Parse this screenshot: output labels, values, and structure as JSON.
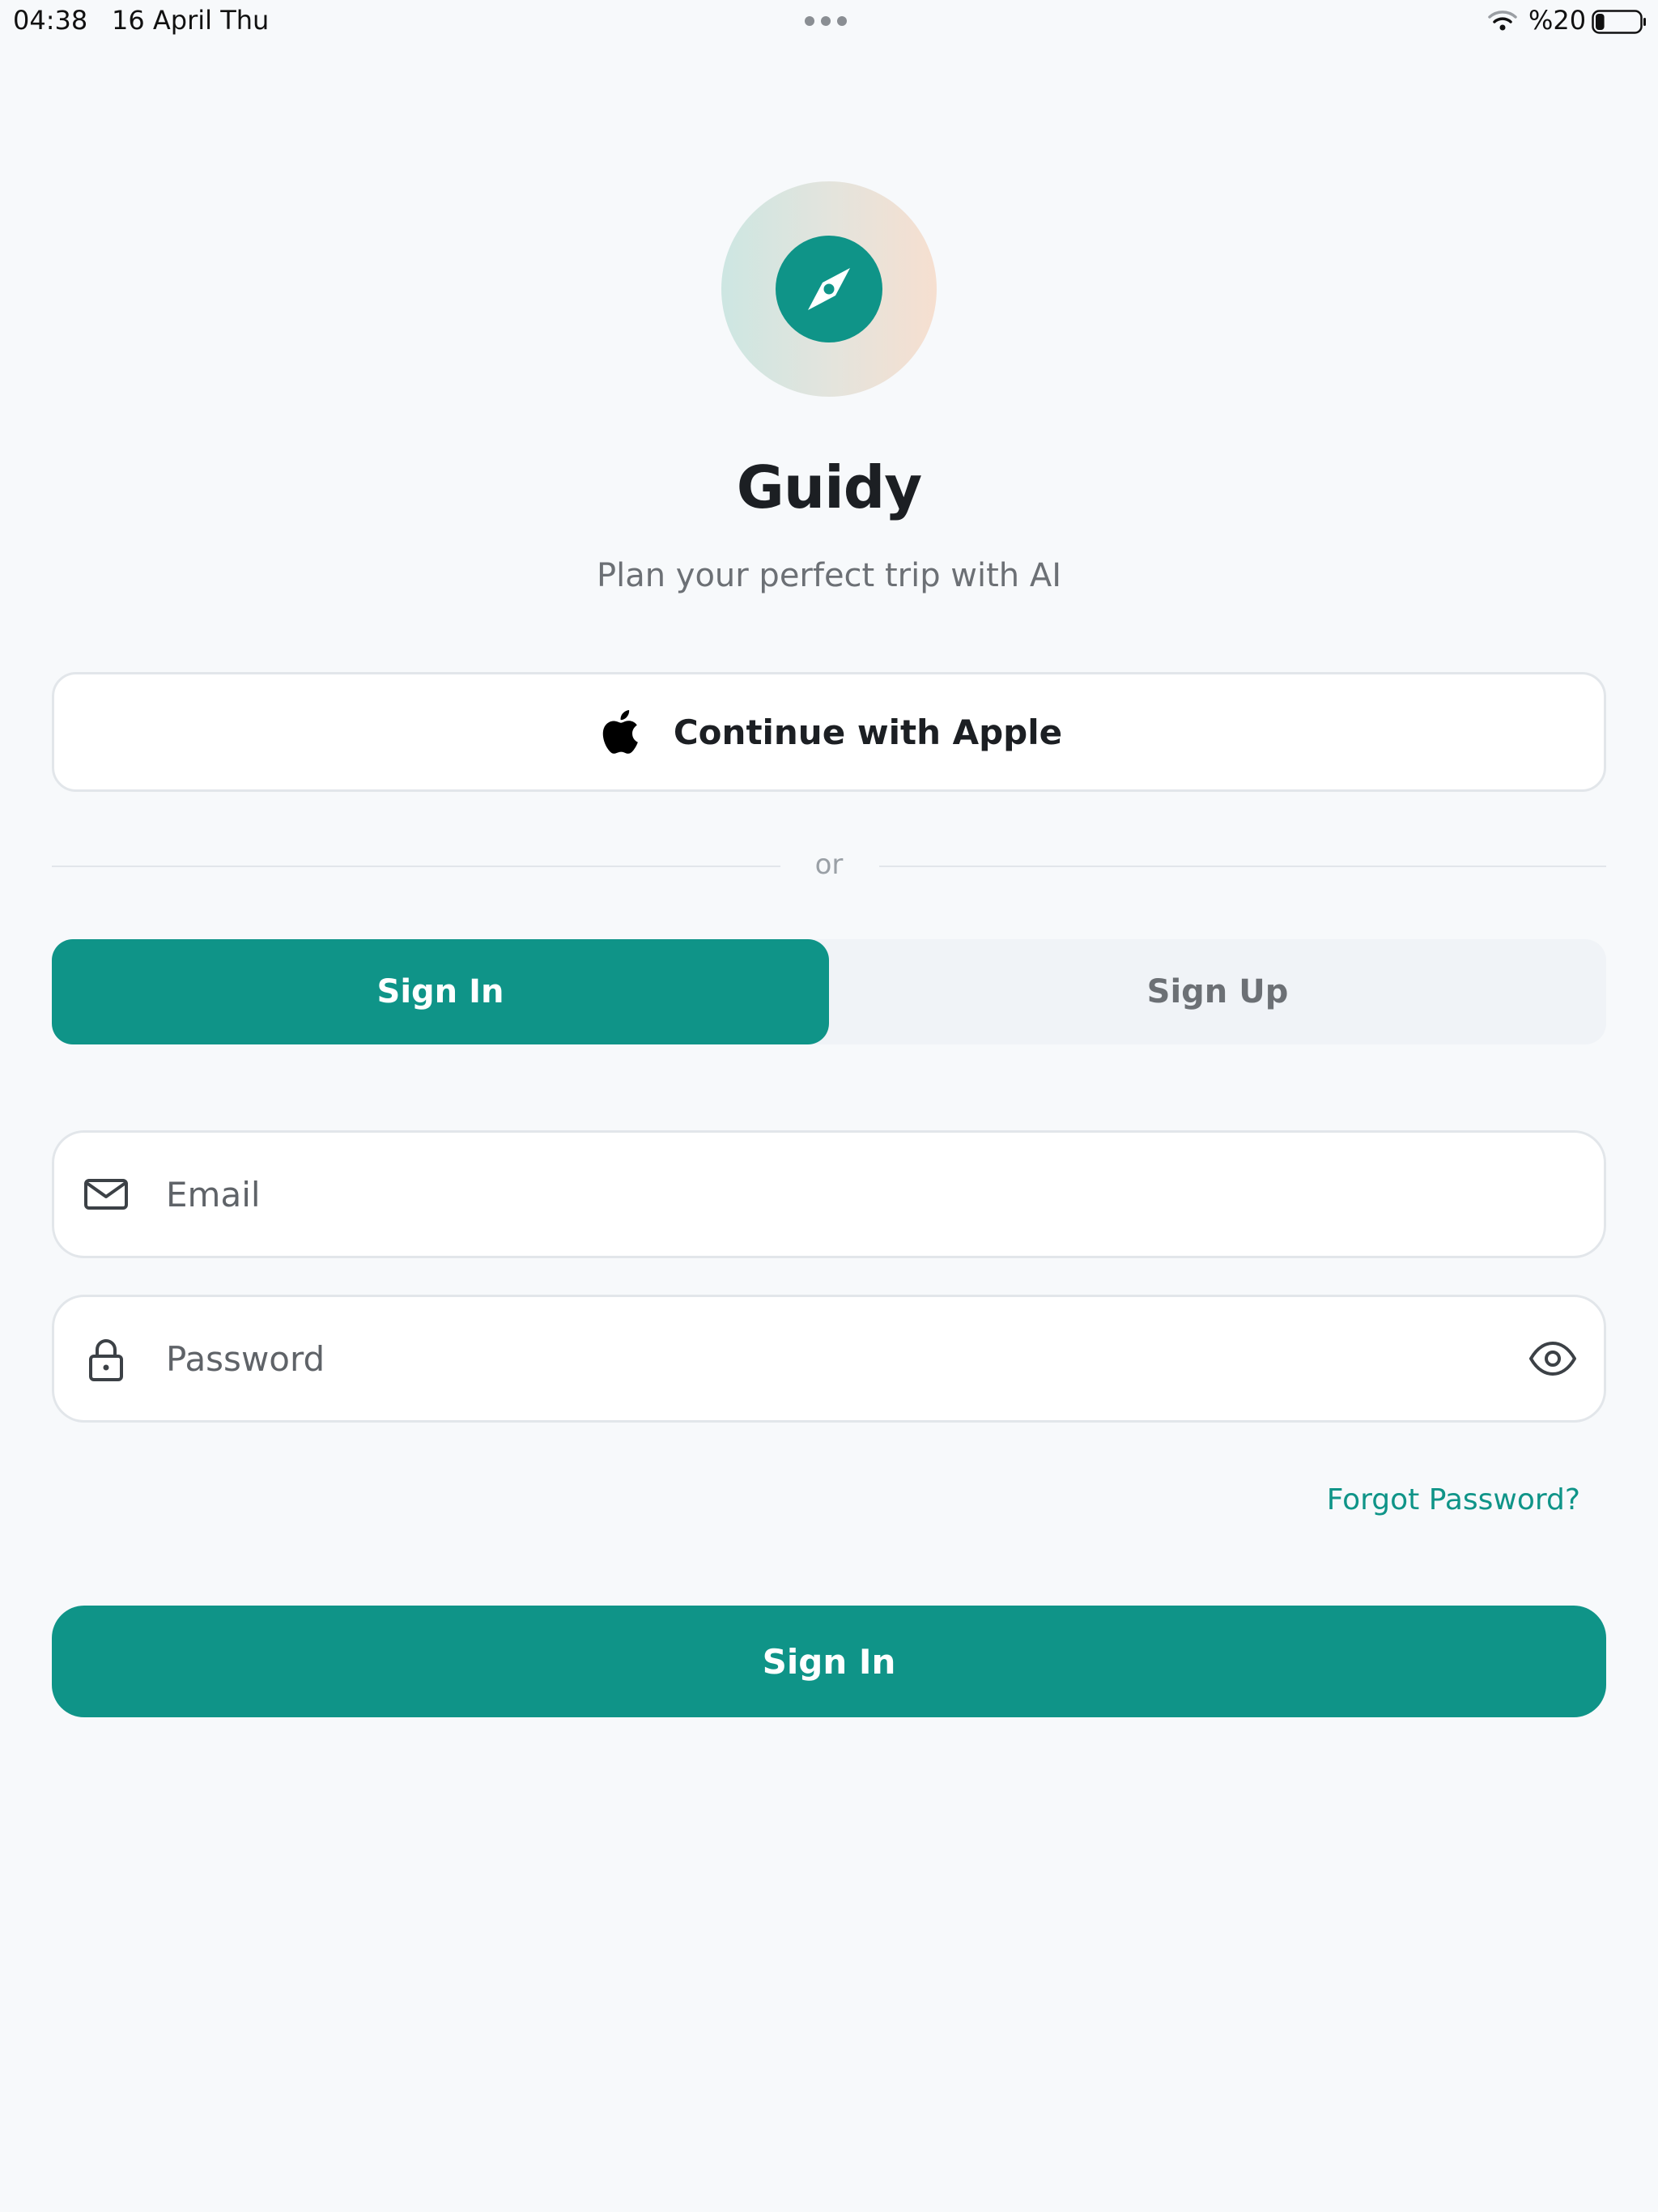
{
  "status_bar": {
    "time": "04:38",
    "date": "16 April Thu",
    "battery_text": "%20",
    "battery_level": 0.2
  },
  "app": {
    "title": "Guidy",
    "subtitle": "Plan your perfect trip with AI",
    "logo_icon": "compass-icon",
    "accent_color": "#0f9488"
  },
  "apple_button": {
    "label": "Continue with Apple",
    "icon": "apple-icon"
  },
  "divider": {
    "text": "or"
  },
  "tabs": [
    {
      "label": "Sign In",
      "active": true
    },
    {
      "label": "Sign Up",
      "active": false
    }
  ],
  "form": {
    "email": {
      "placeholder": "Email",
      "value": "",
      "icon": "mail-icon"
    },
    "password": {
      "placeholder": "Password",
      "value": "",
      "icon": "lock-icon",
      "toggle_icon": "eye-icon"
    },
    "forgot_label": "Forgot Password?",
    "submit_label": "Sign In"
  }
}
